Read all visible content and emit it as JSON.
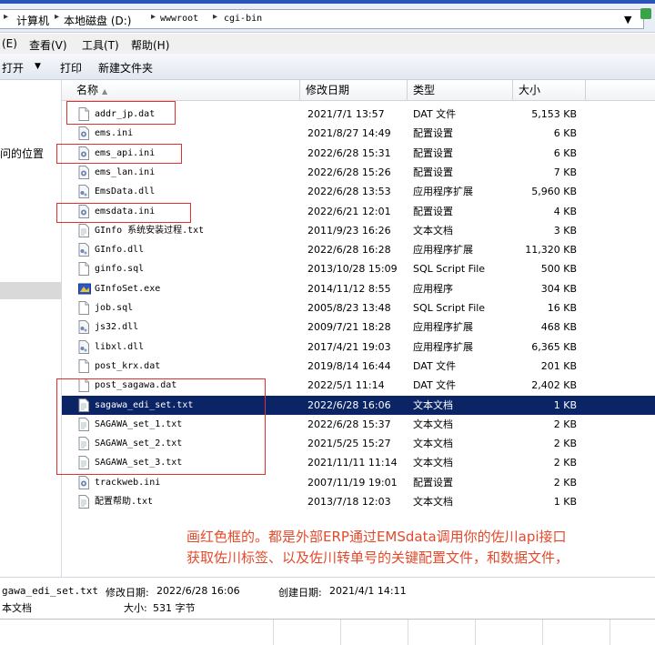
{
  "address": {
    "crumbs": [
      "计算机",
      "本地磁盘 (D:)",
      "wwwroot",
      "cgi-bin"
    ]
  },
  "menu": [
    "(E)",
    "查看(V)",
    "工具(T)",
    "帮助(H)"
  ],
  "toolbar": {
    "open": "打开",
    "print": "打印",
    "new_folder": "新建文件夹"
  },
  "nav": {
    "recent": "问的位置"
  },
  "columns": {
    "name": "名称",
    "date": "修改日期",
    "type": "类型",
    "size": "大小"
  },
  "files": [
    {
      "name": "addr_jp.dat",
      "date": "2021/7/1 13:57",
      "type": "DAT 文件",
      "size": "5,153 KB",
      "icon": "blank-file-icon"
    },
    {
      "name": "ems.ini",
      "date": "2021/8/27 14:49",
      "type": "配置设置",
      "size": "6 KB",
      "icon": "gear-file-icon"
    },
    {
      "name": "ems_api.ini",
      "date": "2022/6/28 15:31",
      "type": "配置设置",
      "size": "6 KB",
      "icon": "gear-file-icon"
    },
    {
      "name": "ems_lan.ini",
      "date": "2022/6/28 15:26",
      "type": "配置设置",
      "size": "7 KB",
      "icon": "gear-file-icon"
    },
    {
      "name": "EmsData.dll",
      "date": "2022/6/28 13:53",
      "type": "应用程序扩展",
      "size": "5,960 KB",
      "icon": "dll-file-icon"
    },
    {
      "name": "emsdata.ini",
      "date": "2022/6/21 12:01",
      "type": "配置设置",
      "size": "4 KB",
      "icon": "gear-file-icon"
    },
    {
      "name": "GInfo 系统安装过程.txt",
      "date": "2011/9/23 16:26",
      "type": "文本文档",
      "size": "3 KB",
      "icon": "text-file-icon"
    },
    {
      "name": "GInfo.dll",
      "date": "2022/6/28 16:28",
      "type": "应用程序扩展",
      "size": "11,320 KB",
      "icon": "dll-file-icon"
    },
    {
      "name": "ginfo.sql",
      "date": "2013/10/28 15:09",
      "type": "SQL Script File",
      "size": "500 KB",
      "icon": "blank-file-icon"
    },
    {
      "name": "GInfoSet.exe",
      "date": "2014/11/12 8:55",
      "type": "应用程序",
      "size": "304 KB",
      "icon": "exe-icon"
    },
    {
      "name": "job.sql",
      "date": "2005/8/23 13:48",
      "type": "SQL Script File",
      "size": "16 KB",
      "icon": "blank-file-icon"
    },
    {
      "name": "js32.dll",
      "date": "2009/7/21 18:28",
      "type": "应用程序扩展",
      "size": "468 KB",
      "icon": "dll-file-icon"
    },
    {
      "name": "libxl.dll",
      "date": "2017/4/21 19:03",
      "type": "应用程序扩展",
      "size": "6,365 KB",
      "icon": "dll-file-icon"
    },
    {
      "name": "post_krx.dat",
      "date": "2019/8/14 16:44",
      "type": "DAT 文件",
      "size": "201 KB",
      "icon": "blank-file-icon"
    },
    {
      "name": "post_sagawa.dat",
      "date": "2022/5/1 11:14",
      "type": "DAT 文件",
      "size": "2,402 KB",
      "icon": "blank-file-icon"
    },
    {
      "name": "sagawa_edi_set.txt",
      "date": "2022/6/28 16:06",
      "type": "文本文档",
      "size": "1 KB",
      "icon": "text-file-icon"
    },
    {
      "name": "SAGAWA_set_1.txt",
      "date": "2022/6/28 15:37",
      "type": "文本文档",
      "size": "2 KB",
      "icon": "text-file-icon"
    },
    {
      "name": "SAGAWA_set_2.txt",
      "date": "2021/5/25 15:27",
      "type": "文本文档",
      "size": "2 KB",
      "icon": "text-file-icon"
    },
    {
      "name": "SAGAWA_set_3.txt",
      "date": "2021/11/11 11:14",
      "type": "文本文档",
      "size": "2 KB",
      "icon": "text-file-icon"
    },
    {
      "name": "trackweb.ini",
      "date": "2007/11/19 19:01",
      "type": "配置设置",
      "size": "2 KB",
      "icon": "gear-file-icon"
    },
    {
      "name": "配置帮助.txt",
      "date": "2013/7/18 12:03",
      "type": "文本文档",
      "size": "1 KB",
      "icon": "text-file-icon"
    }
  ],
  "selected_index": 15,
  "annotation": {
    "line1": "画红色框的。都是外部ERP通过EMSdata调用你的佐川api接口",
    "line2": "获取佐川标签、以及佐川转单号的关键配置文件，和数据文件，",
    "color": "#e34a2b"
  },
  "status": {
    "filename": "gawa_edi_set.txt",
    "modified_label": "修改日期:",
    "modified": "2022/6/28 16:06",
    "created_label": "创建日期:",
    "created": "2021/4/1 14:11",
    "type": "本文档",
    "size_label": "大小:",
    "size": "531 字节"
  }
}
